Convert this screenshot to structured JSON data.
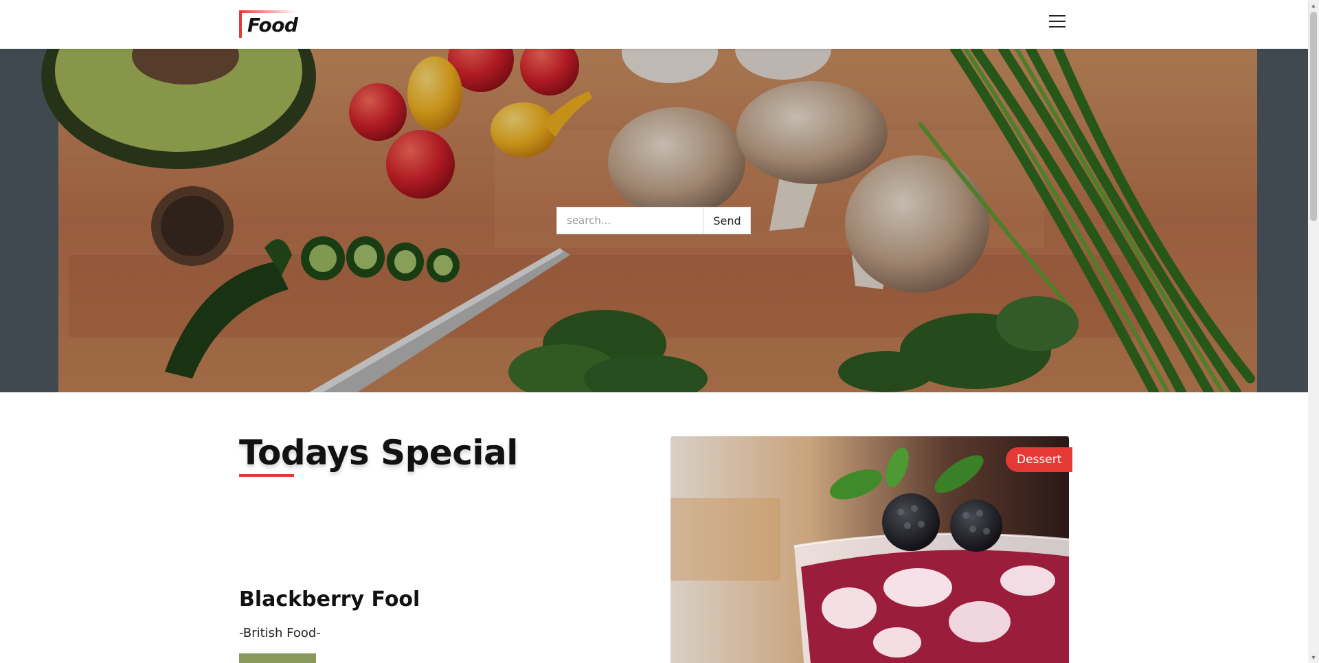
{
  "header": {
    "logo_text": "Food",
    "menu_icon": "hamburger-menu-icon"
  },
  "hero": {
    "image": "cutting board with vegetables",
    "search_placeholder": "search...",
    "search_value": "",
    "send_label": "Send"
  },
  "special": {
    "section_title": "Todays Special",
    "dish_name": "Blackberry Fool",
    "dish_origin": "-British Food-",
    "category_tag": "Dessert",
    "dish_image": "blackberry fool dessert in glass"
  },
  "colors": {
    "accent": "#e53935",
    "button_green": "#8a9a5b",
    "text": "#111111"
  },
  "scrollbar": {
    "up_icon": "arrow-up-icon",
    "down_icon": "arrow-down-icon"
  }
}
